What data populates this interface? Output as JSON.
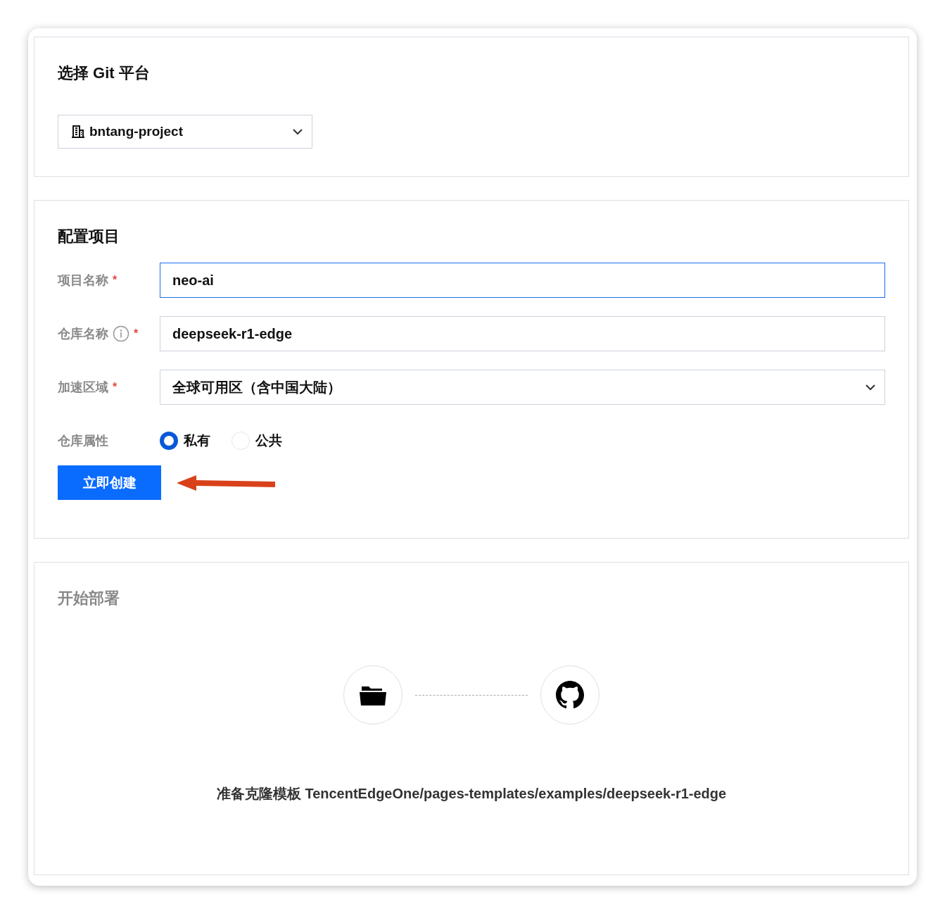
{
  "platform_section": {
    "title": "选择 Git 平台",
    "org_select": {
      "value": "bntang-project"
    }
  },
  "config_section": {
    "title": "配置项目",
    "fields": [
      {
        "kind": "input",
        "label": "项目名称",
        "required_mark": "*",
        "value": "neo-ai",
        "focused": true
      },
      {
        "kind": "input",
        "label": "仓库名称",
        "info": true,
        "required_mark": "*",
        "value": "deepseek-r1-edge",
        "focused": false
      },
      {
        "kind": "select",
        "label": "加速区域",
        "required_mark": "*",
        "value": "全球可用区（含中国大陆）",
        "focused": false
      },
      {
        "kind": "radio",
        "label": "仓库属性",
        "options": [
          {
            "label": "私有",
            "selected": true
          },
          {
            "label": "公共",
            "selected": false
          }
        ]
      }
    ],
    "create_button": "立即创建"
  },
  "deploy_section": {
    "title": "开始部署",
    "status": "准备克隆模板 TencentEdgeOne/pages-templates/examples/deepseek-r1-edge"
  }
}
